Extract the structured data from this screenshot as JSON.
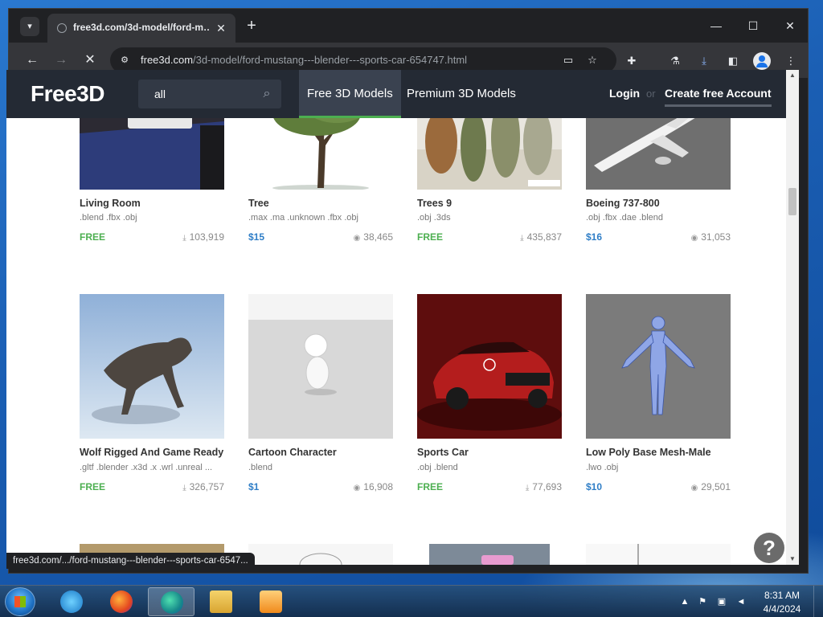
{
  "browser": {
    "tab_title": "free3d.com/3d-model/ford-m…",
    "url_host": "free3d.com",
    "url_path": "/3d-model/ford-mustang---blender---sports-car-654747.html",
    "status_url": "free3d.com/.../ford-mustang---blender---sports-car-6547..."
  },
  "site": {
    "logo": "Free3D",
    "search_value": "all",
    "nav": [
      "Free 3D Models",
      "Premium 3D Models"
    ],
    "login": "Login",
    "or": "or",
    "create_account": "Create free Account"
  },
  "colors": {
    "free": "#4caf50",
    "paid": "#2f7ec7"
  },
  "models": [
    {
      "title": "Living Room",
      "formats": ".blend .fbx .obj",
      "price": "FREE",
      "stat": "103,919",
      "stat_icon": "download-icon"
    },
    {
      "title": "Tree",
      "formats": ".max .ma .unknown .fbx .obj",
      "price": "$15",
      "stat": "38,465",
      "stat_icon": "eye-icon"
    },
    {
      "title": "Trees 9",
      "formats": ".obj .3ds",
      "price": "FREE",
      "stat": "435,837",
      "stat_icon": "download-icon"
    },
    {
      "title": "Boeing 737-800",
      "formats": ".obj .fbx .dae .blend",
      "price": "$16",
      "stat": "31,053",
      "stat_icon": "eye-icon"
    },
    {
      "title": "Wolf Rigged And Game Ready",
      "formats": ".gltf .blender .x3d .x .wrl .unreal ...",
      "price": "FREE",
      "stat": "326,757",
      "stat_icon": "download-icon"
    },
    {
      "title": "Cartoon Character",
      "formats": ".blend",
      "price": "$1",
      "stat": "16,908",
      "stat_icon": "eye-icon"
    },
    {
      "title": "Sports Car",
      "formats": ".obj .blend",
      "price": "FREE",
      "stat": "77,693",
      "stat_icon": "download-icon"
    },
    {
      "title": "Low Poly Base Mesh-Male",
      "formats": ".lwo .obj",
      "price": "$10",
      "stat": "29,501",
      "stat_icon": "eye-icon"
    }
  ],
  "help": "?",
  "taskbar": {
    "time": "8:31 AM",
    "date": "4/4/2024"
  }
}
